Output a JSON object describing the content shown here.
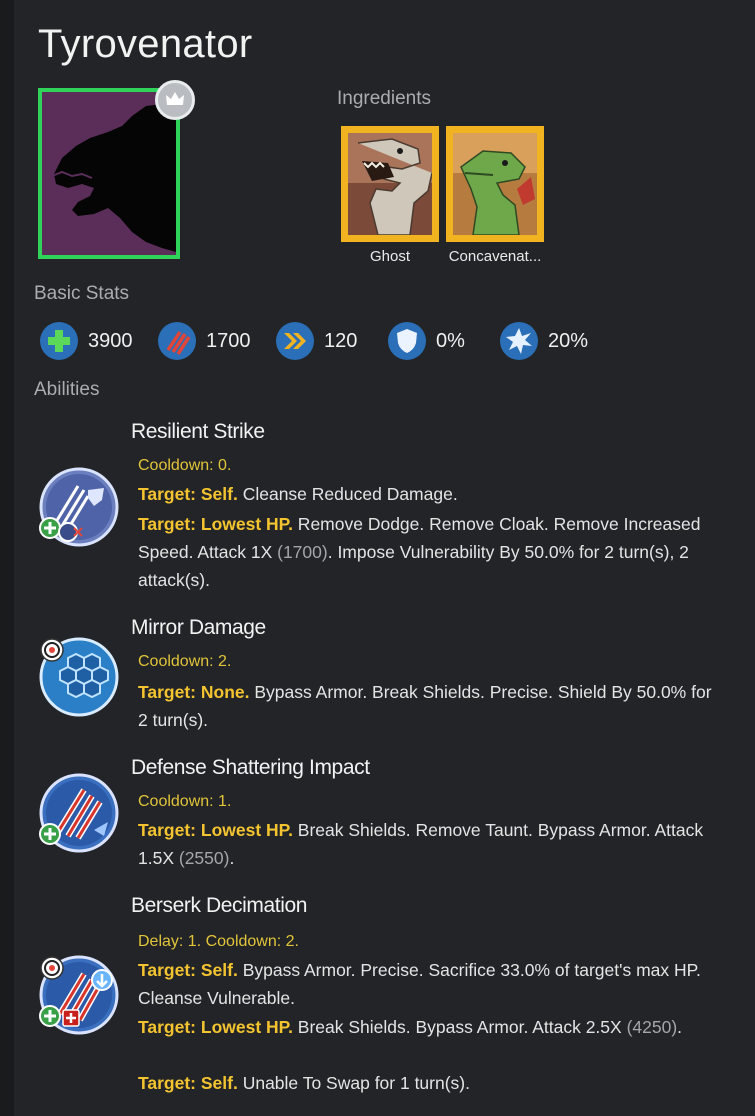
{
  "title": "Tyrovenator",
  "ingredients": {
    "label": "Ingredients",
    "items": [
      {
        "name": "Ghost",
        "icon": "ghost-dino-portrait"
      },
      {
        "name": "Concavenat...",
        "icon": "concavenator-portrait"
      }
    ]
  },
  "basic_stats": {
    "label": "Basic Stats",
    "items": [
      {
        "name": "health",
        "icon": "health-plus-icon",
        "value": "3900"
      },
      {
        "name": "damage",
        "icon": "damage-claw-icon",
        "value": "1700"
      },
      {
        "name": "speed",
        "icon": "speed-chevron-icon",
        "value": "120"
      },
      {
        "name": "armor",
        "icon": "armor-shield-icon",
        "value": "0%"
      },
      {
        "name": "crit",
        "icon": "crit-burst-icon",
        "value": "20%"
      }
    ]
  },
  "abilities": {
    "label": "Abilities",
    "items": [
      {
        "name": "Resilient Strike",
        "cooldown": "Cooldown: 0.",
        "lines": [
          {
            "target": "Target: Self.",
            "text": " Cleanse Reduced Damage."
          },
          {
            "target": "Target: Lowest HP.",
            "text": " Remove Dodge. Remove Cloak. Remove Increased Speed. Attack 1X ",
            "num": "(1700)",
            "tail": ". Impose Vulnerability By 50.0% for 2 turn(s), 2 attack(s)."
          }
        ]
      },
      {
        "name": "Mirror Damage",
        "cooldown": "Cooldown: 2.",
        "lines": [
          {
            "target": "Target: None.",
            "text": " Bypass Armor. Break Shields. Precise. Shield By 50.0% for 2 turn(s)."
          }
        ]
      },
      {
        "name": "Defense Shattering Impact",
        "cooldown": "Cooldown: 1.",
        "lines": [
          {
            "target": "Target: Lowest HP.",
            "text": " Break Shields. Remove Taunt. Bypass Armor. Attack 1.5X ",
            "num": "(2550)",
            "tail": "."
          }
        ]
      },
      {
        "name": "Berserk Decimation",
        "cooldown": "Delay: 1. Cooldown: 2.",
        "lines": [
          {
            "target": "Target: Self.",
            "text": " Bypass Armor. Precise. Sacrifice 33.0% of target's max HP. Cleanse Vulnerable."
          },
          {
            "target": "Target: Lowest HP.",
            "text": " Break Shields. Bypass Armor. Attack 2.5X ",
            "num": "(4250)",
            "tail": "."
          },
          {
            "target": "Target: Self.",
            "text": " Unable To Swap for 1 turn(s)."
          }
        ]
      }
    ]
  },
  "colors": {
    "background": "#222427",
    "cooldown": "#e2c43a",
    "target": "#f4c430",
    "stat_icon": "#2a6fb7",
    "portrait_border": "#2fd35a",
    "card_border": "#f2b321"
  }
}
